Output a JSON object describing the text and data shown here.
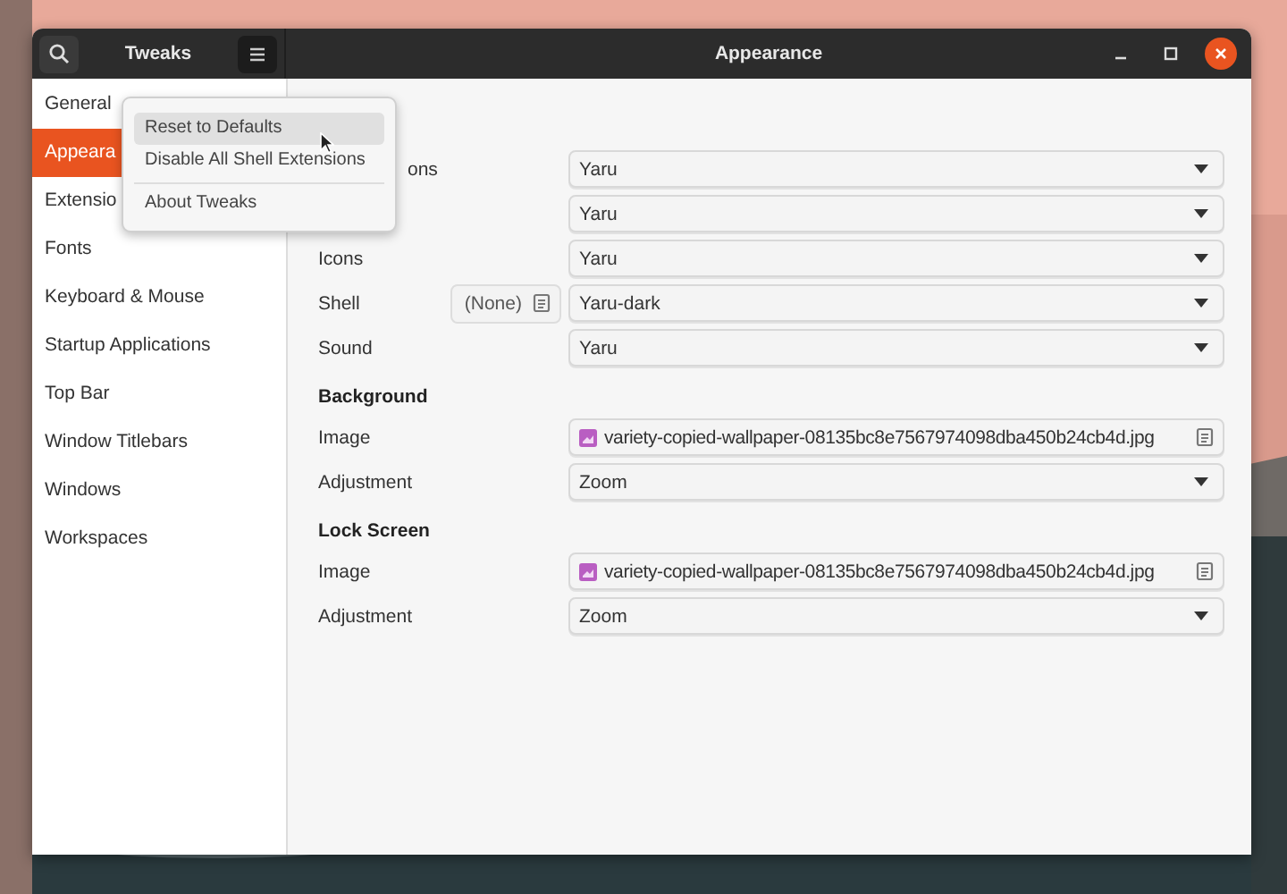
{
  "window": {
    "app_title": "Tweaks",
    "page_title": "Appearance"
  },
  "sidebar": {
    "items": [
      {
        "label": "General",
        "selected": false
      },
      {
        "label": "Appeara",
        "selected": true
      },
      {
        "label": "Extensio",
        "selected": false
      },
      {
        "label": "Fonts",
        "selected": false
      },
      {
        "label": "Keyboard & Mouse",
        "selected": false
      },
      {
        "label": "Startup Applications",
        "selected": false
      },
      {
        "label": "Top Bar",
        "selected": false
      },
      {
        "label": "Window Titlebars",
        "selected": false
      },
      {
        "label": "Windows",
        "selected": false
      },
      {
        "label": "Workspaces",
        "selected": false
      }
    ]
  },
  "menu": {
    "items": [
      {
        "label": "Reset to Defaults",
        "selected": true,
        "separator_before": false
      },
      {
        "label": "Disable All Shell Extensions",
        "selected": false,
        "separator_before": false
      },
      {
        "label": "About Tweaks",
        "selected": false,
        "separator_before": true
      }
    ]
  },
  "rows": [
    {
      "kind": "dropdown",
      "label": "ons",
      "value": "Yaru"
    },
    {
      "kind": "dropdown",
      "value": "Yaru"
    },
    {
      "kind": "dropdown",
      "label": "Icons",
      "value": "Yaru"
    },
    {
      "kind": "dropdown",
      "label": "Shell",
      "value": "Yaru-dark",
      "side_button": "(None)"
    },
    {
      "kind": "dropdown",
      "label": "Sound",
      "value": "Yaru"
    },
    {
      "kind": "heading",
      "label": "Background"
    },
    {
      "kind": "file",
      "label": "Image",
      "value": "variety-copied-wallpaper-08135bc8e7567974098dba450b24cb4d.jpg"
    },
    {
      "kind": "dropdown",
      "label": "Adjustment",
      "value": "Zoom"
    },
    {
      "kind": "heading",
      "label": "Lock Screen"
    },
    {
      "kind": "file",
      "label": "Image",
      "value": "variety-copied-wallpaper-08135bc8e7567974098dba450b24cb4d.jpg"
    },
    {
      "kind": "dropdown",
      "label": "Adjustment",
      "value": "Zoom"
    }
  ]
}
